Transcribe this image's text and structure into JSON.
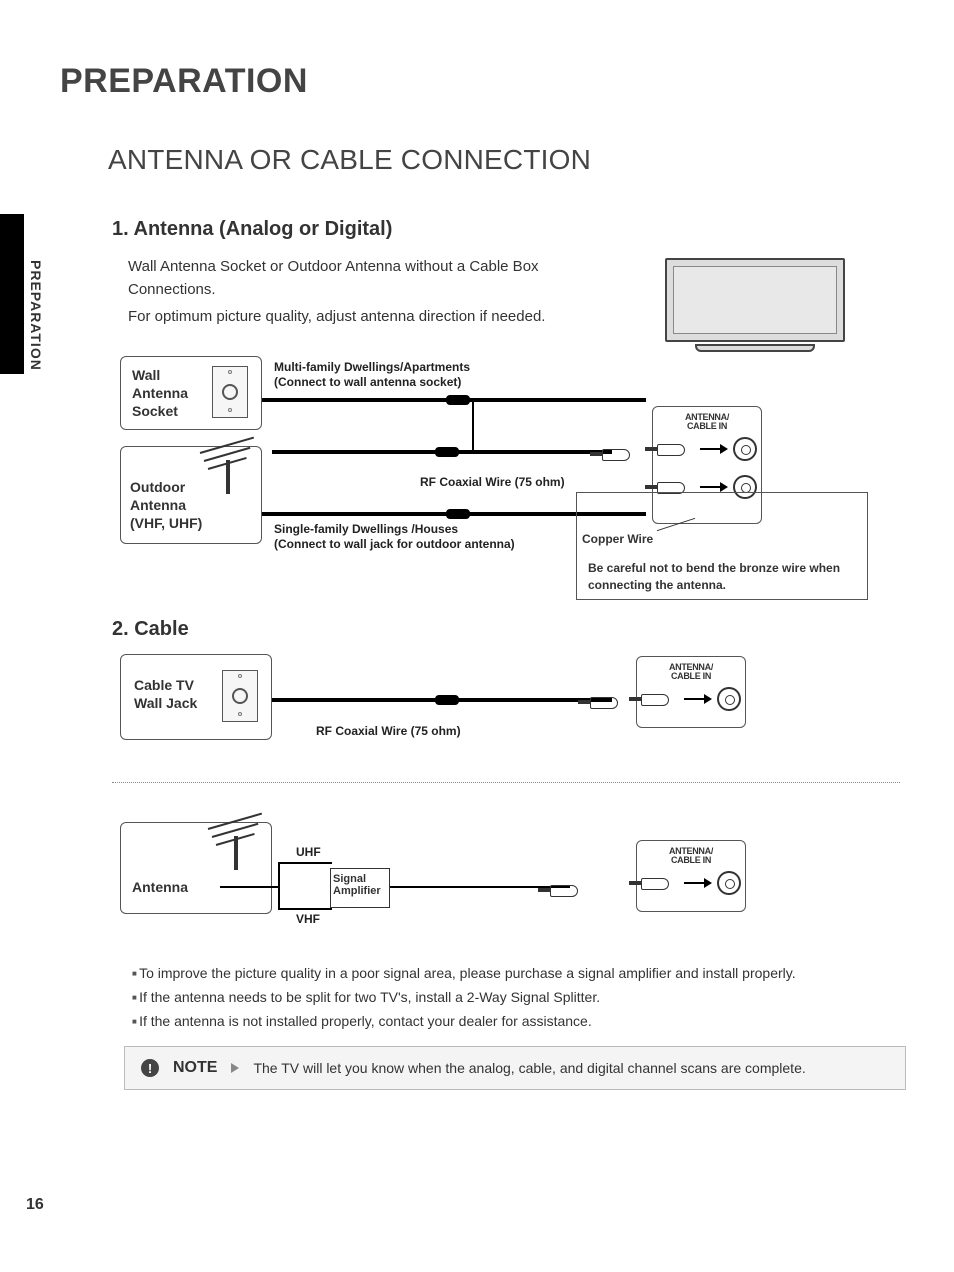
{
  "page": {
    "number": "16",
    "title": "PREPARATION",
    "subtitle": "ANTENNA OR CABLE CONNECTION",
    "sidebar": "PREPARATION"
  },
  "section1": {
    "heading": "1. Antenna (Analog or Digital)",
    "intro_line1": "Wall Antenna Socket or Outdoor Antenna without a Cable Box Connections.",
    "intro_line2": "For optimum picture quality, adjust antenna direction if needed.",
    "labels": {
      "wall_socket": "Wall\nAntenna\nSocket",
      "outdoor": "Outdoor\nAntenna\n(VHF, UHF)",
      "multi": "Multi-family Dwellings/Apartments\n(Connect to wall antenna socket)",
      "rf": "RF Coaxial Wire (75 ohm)",
      "single": "Single-family Dwellings /Houses\n(Connect to wall jack for outdoor antenna)",
      "ant_in": "ANTENNA/\nCABLE IN",
      "copper": "Copper Wire",
      "warn": "Be careful not to bend the bronze wire when connecting the antenna."
    }
  },
  "section2": {
    "heading": "2. Cable",
    "labels": {
      "cabletv": "Cable TV\nWall Jack",
      "rf": "RF Coaxial Wire (75 ohm)",
      "ant_in": "ANTENNA/\nCABLE IN"
    }
  },
  "amp_diagram": {
    "antenna": "Antenna",
    "uhf": "UHF",
    "vhf": "VHF",
    "amp": "Signal\nAmplifier",
    "ant_in": "ANTENNA/\nCABLE IN"
  },
  "bullets": [
    "To improve the picture quality in a poor signal area, please purchase a signal amplifier and install properly.",
    "If the antenna needs to be split for two TV's, install a 2-Way Signal Splitter.",
    "If the antenna is not installed properly, contact your dealer for assistance."
  ],
  "note": {
    "label": "NOTE",
    "text": "The TV will let you know when the analog, cable, and digital channel scans are complete."
  }
}
